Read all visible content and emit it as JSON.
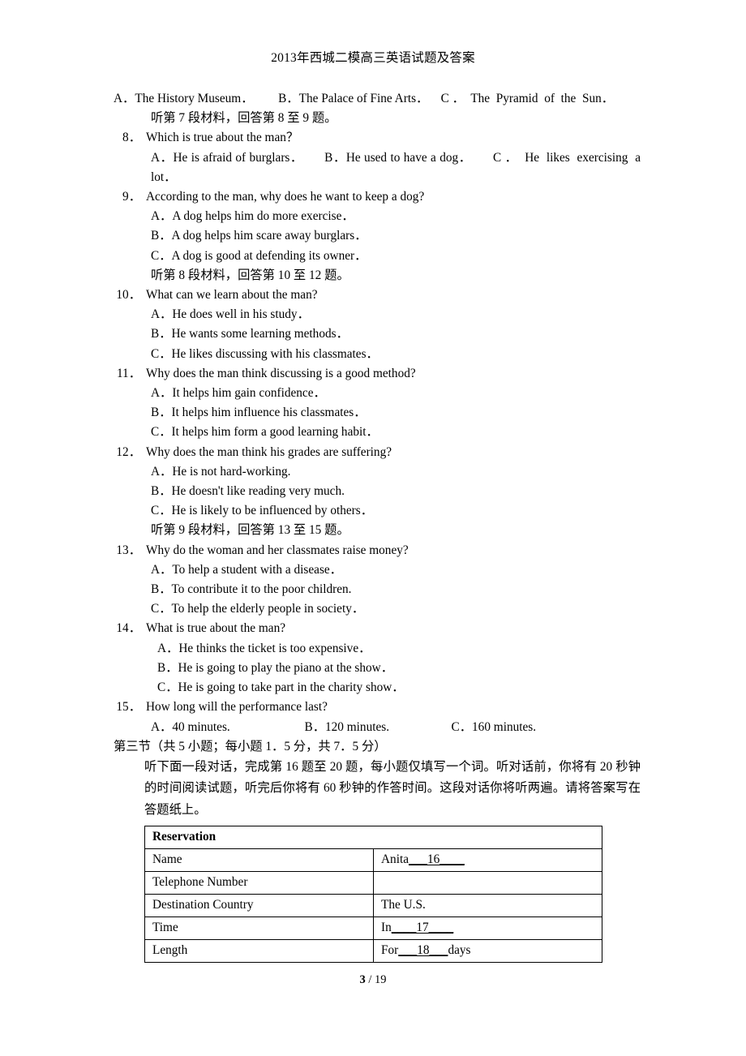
{
  "header": {
    "title": "2013年西城二模高三英语试题及答案"
  },
  "body": {
    "q7_options_line": "A．The History Museum．        B．The Palace of Fine Arts．    C ．  The  Pyramid  of  the  Sun．",
    "dir_7": "听第 7 段材料，回答第 8 至 9 题。",
    "q8": {
      "num": "8．",
      "text": "Which is true about the man？",
      "options_inline": "A．He is afraid of burglars．      B．He used to have a dog．      C ．  He  likes  exercising  a  lot．"
    },
    "q9": {
      "num": "9．",
      "text": "According to the man, why does he want to keep a dog?",
      "options": [
        "A．A dog helps him do more exercise．",
        "B．A dog helps him scare away burglars．",
        "C．A dog is good at defending its owner．"
      ]
    },
    "dir_8": "听第 8 段材料，回答第 10 至 12 题。",
    "q10": {
      "num": "10．",
      "text": "What can we learn about the man?",
      "options": [
        "A．He does well in his study．",
        "B．He wants some learning methods．",
        "C．He likes discussing with his classmates．"
      ]
    },
    "q11": {
      "num": "11．",
      "text": "Why does the man think discussing is a good method?",
      "options": [
        "A．It helps him gain confidence．",
        "B．It helps him influence his classmates．",
        "C．It helps him form a good learning habit．"
      ]
    },
    "q12": {
      "num": "12．",
      "text": "Why does the man think his grades are suffering?",
      "options": [
        "A．He is not hard-working.",
        "B．He doesn't like reading very much.",
        "C．He is likely to be influenced by others．"
      ]
    },
    "dir_9": "听第 9 段材料，回答第 13 至 15 题。",
    "q13": {
      "num": "13．",
      "text": "Why do the woman and her classmates raise money?",
      "options": [
        "A．To help a student with a disease．",
        "B．To contribute it to the poor children.",
        "C．To help the elderly people in society．"
      ]
    },
    "q14": {
      "num": "14．",
      "text": "What is true about the man?",
      "options": [
        "A．He thinks the ticket is too expensive．",
        "B．He is going to play the piano at the show．",
        "C．He is going to take part in the charity show．"
      ]
    },
    "q15": {
      "num": "15．",
      "text": "How long will the performance last?",
      "options_inline": "A．40 minutes.                        B．120 minutes.                    C．160 minutes."
    },
    "section3_heading": "第三节（共 5 小题；每小题 1．5 分，共 7．5 分）",
    "section3_instructions": "听下面一段对话，完成第 16 题至 20 题，每小题仅填写一个词。听对话前，你将有 20 秒钟的时间阅读试题，听完后你将有 60 秒钟的作答时间。这段对话你将听两遍。请将答案写在答题纸上。"
  },
  "table": {
    "title": "Reservation",
    "rows": [
      {
        "label": "Name",
        "value_prefix": "Anita",
        "blank": "___16____",
        "value_suffix": ""
      },
      {
        "label": "Telephone Number",
        "value_prefix": "",
        "blank": "",
        "value_suffix": ""
      },
      {
        "label": "Destination Country",
        "value_prefix": "The U.S.",
        "blank": "",
        "value_suffix": ""
      },
      {
        "label": "Time",
        "value_prefix": "In",
        "blank": "____17____",
        "value_suffix": ""
      },
      {
        "label": "Length",
        "value_prefix": "For",
        "blank": "___18___",
        "value_suffix": "days"
      }
    ]
  },
  "footer": {
    "page": "3",
    "separator": " / ",
    "total": "19"
  }
}
